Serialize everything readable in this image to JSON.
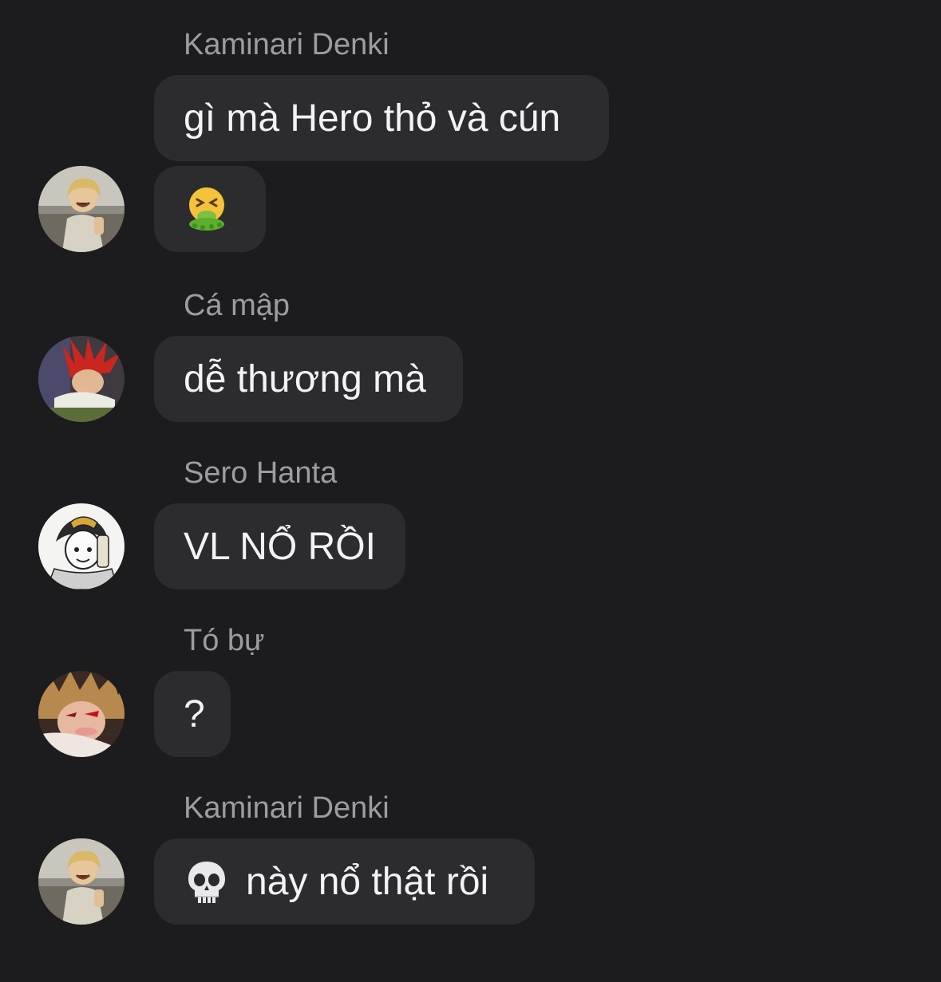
{
  "messages": [
    {
      "sender": "Kaminari Denki",
      "bubbles": [
        {
          "text": "gì mà Hero thỏ và cún"
        },
        {
          "emoji": "vomiting-face-icon"
        }
      ]
    },
    {
      "sender": "Cá mập",
      "bubbles": [
        {
          "text": "dễ thương mà"
        }
      ]
    },
    {
      "sender": "Sero Hanta",
      "bubbles": [
        {
          "text": "VL NỔ RỒI"
        }
      ]
    },
    {
      "sender": "Tó bự",
      "bubbles": [
        {
          "text": "?"
        }
      ]
    },
    {
      "sender": "Kaminari Denki",
      "bubbles": [
        {
          "emoji": "skull-icon",
          "text": "này nổ thật rồi"
        }
      ]
    }
  ],
  "colors": {
    "background": "#1c1c1e",
    "bubble": "#2c2c2e",
    "sender_text": "#9c9ca3",
    "message_text": "#f2f2f7"
  }
}
